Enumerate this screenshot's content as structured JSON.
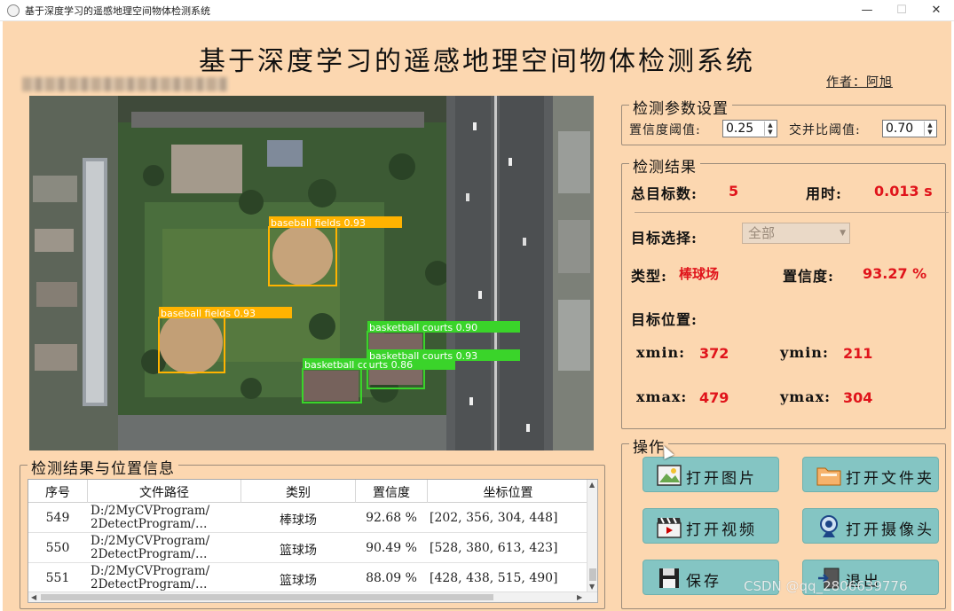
{
  "window": {
    "title": "基于深度学习的遥感地理空间物体检测系统",
    "minimize": "—",
    "maximize": "☐",
    "close": "✕"
  },
  "header": {
    "title": "基于深度学习的遥感地理空间物体检测系统",
    "author": "作者：阿旭"
  },
  "image": {
    "detections": [
      {
        "label": "baseball fields 0.93",
        "color": "#ffb300"
      },
      {
        "label": "baseball fields 0.93",
        "color": "#ffb300"
      },
      {
        "label": "basketball courts 0.90",
        "color": "#3ad42a"
      },
      {
        "label": "basketball courts 0.86",
        "color": "#3ad42a"
      },
      {
        "label": "basketball courts 0.93",
        "color": "#3ad42a"
      }
    ]
  },
  "params": {
    "group_title": "检测参数设置",
    "conf_label": "置信度阈值:",
    "conf_value": "0.25",
    "iou_label": "交并比阈值:",
    "iou_value": "0.70"
  },
  "results": {
    "group_title": "检测结果",
    "total_label": "总目标数:",
    "total_value": "5",
    "time_label": "用时:",
    "time_value": "0.013 s",
    "select_label": "目标选择:",
    "select_value": "全部",
    "type_label": "类型:",
    "type_value": "棒球场",
    "conf_label": "置信度:",
    "conf_value": "93.27 %",
    "position_label": "目标位置:",
    "xmin_label": "xmin:",
    "xmin_value": "372",
    "ymin_label": "ymin:",
    "ymin_value": "211",
    "xmax_label": "xmax:",
    "xmax_value": "479",
    "ymax_label": "ymax:",
    "ymax_value": "304"
  },
  "operations": {
    "group_title": "操作",
    "open_image": "打开图片",
    "open_folder": "打开文件夹",
    "open_video": "打开视频",
    "open_camera": "打开摄像头",
    "save": "保存",
    "exit": "退出"
  },
  "table": {
    "group_title": "检测结果与位置信息",
    "headers": [
      "序号",
      "文件路径",
      "类别",
      "置信度",
      "坐标位置"
    ],
    "rows": [
      {
        "id": "549",
        "path1": "D:/2MyCVProgram/",
        "path2": "2DetectProgram/…",
        "cls": "棒球场",
        "conf": "92.68 %",
        "box": "[202, 356, 304, 448]"
      },
      {
        "id": "550",
        "path1": "D:/2MyCVProgram/",
        "path2": "2DetectProgram/…",
        "cls": "篮球场",
        "conf": "90.49 %",
        "box": "[528, 380, 613, 423]"
      },
      {
        "id": "551",
        "path1": "D:/2MyCVProgram/",
        "path2": "2DetectProgram/…",
        "cls": "篮球场",
        "conf": "88.09 %",
        "box": "[428, 438, 515, 490]"
      }
    ]
  },
  "watermark": "CSDN @qq_2806639776"
}
